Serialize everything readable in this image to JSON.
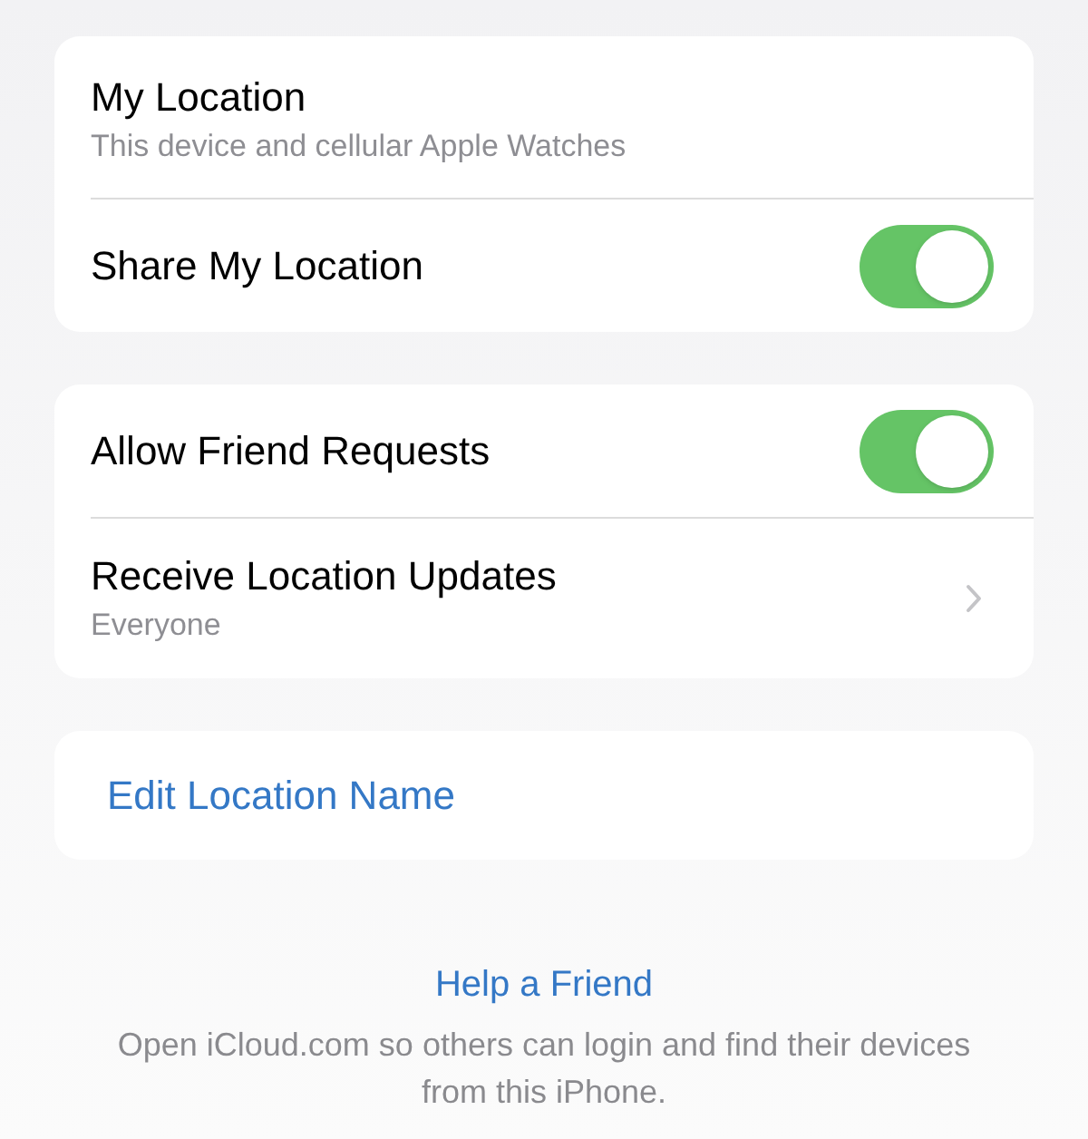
{
  "groups": [
    {
      "rows": [
        {
          "kind": "info",
          "title": "My Location",
          "subtitle": "This device and cellular Apple Watches"
        },
        {
          "kind": "toggle",
          "title": "Share My Location",
          "on": true
        }
      ]
    },
    {
      "rows": [
        {
          "kind": "toggle",
          "title": "Allow Friend Requests",
          "on": true
        },
        {
          "kind": "disclosure",
          "title": "Receive Location Updates",
          "subtitle": "Everyone"
        }
      ]
    },
    {
      "rows": [
        {
          "kind": "link",
          "title": "Edit Location Name"
        }
      ]
    }
  ],
  "footer": {
    "link": "Help a Friend",
    "description": "Open iCloud.com so others can login and find their devices from this iPhone."
  }
}
